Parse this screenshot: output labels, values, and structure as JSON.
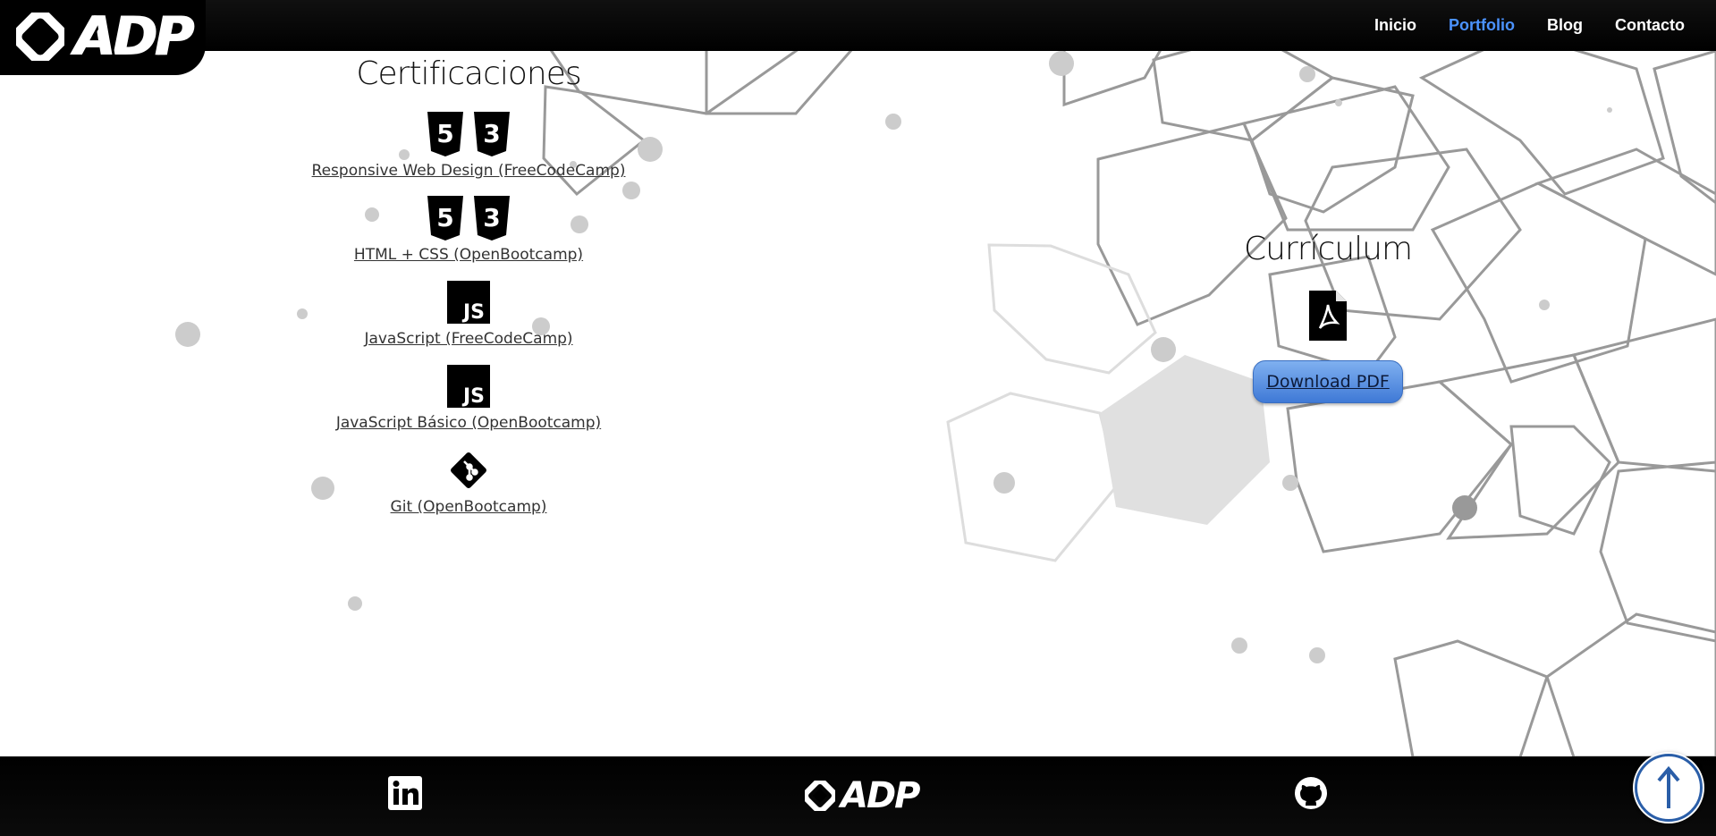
{
  "header": {
    "logo_text": "ADP",
    "nav": [
      {
        "label": "Inicio",
        "active": false
      },
      {
        "label": "Portfolio",
        "active": true
      },
      {
        "label": "Blog",
        "active": false
      },
      {
        "label": "Contacto",
        "active": false
      }
    ]
  },
  "certifications": {
    "title": "Certificaciones",
    "items": [
      {
        "label": "Responsive Web Design (FreeCodeCamp)",
        "icons": [
          "html5-icon",
          "css3-icon"
        ]
      },
      {
        "label": "HTML + CSS (OpenBootcamp)",
        "icons": [
          "html5-icon",
          "css3-icon"
        ]
      },
      {
        "label": "JavaScript (FreeCodeCamp)",
        "icons": [
          "javascript-icon"
        ]
      },
      {
        "label": "JavaScript Básico (OpenBootcamp)",
        "icons": [
          "javascript-icon"
        ]
      },
      {
        "label": "Git (OpenBootcamp)",
        "icons": [
          "git-icon"
        ]
      }
    ]
  },
  "curriculum": {
    "title": "Currículum",
    "icon": "pdf-file-icon",
    "button_label": "Download PDF"
  },
  "footer": {
    "logo_text": "ADP",
    "icons": [
      "linkedin-icon",
      "github-icon"
    ]
  },
  "scroll_top": {
    "icon": "arrow-up-icon"
  },
  "colors": {
    "nav_active": "#4b93ff",
    "header_bg": "#000000",
    "button_gradient_top": "#7fb0f0",
    "button_gradient_bottom": "#3f79d6"
  }
}
